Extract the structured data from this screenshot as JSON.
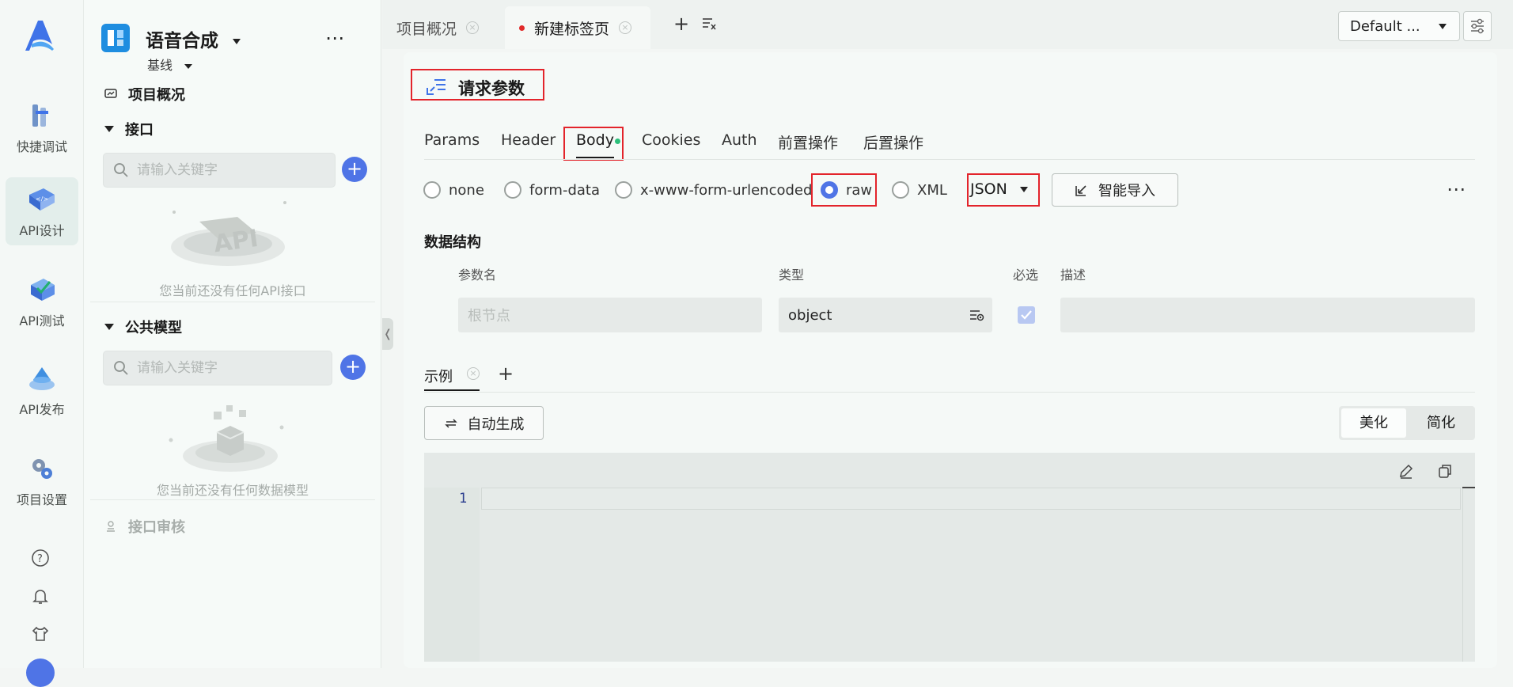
{
  "rail": {
    "items": [
      {
        "label": "快捷调试",
        "icon": "quick-debug-icon"
      },
      {
        "label": "API设计",
        "icon": "api-design-icon",
        "active": true
      },
      {
        "label": "API测试",
        "icon": "api-test-icon"
      },
      {
        "label": "API发布",
        "icon": "api-publish-icon"
      },
      {
        "label": "项目设置",
        "icon": "project-settings-icon"
      }
    ]
  },
  "sidebar": {
    "project_name": "语音合成",
    "branch": "基线",
    "overview_label": "项目概况",
    "interfaces": {
      "title": "接口",
      "search_placeholder": "请输入关键字",
      "empty_text": "您当前还没有任何API接口",
      "empty_art_text": "API"
    },
    "models": {
      "title": "公共模型",
      "search_placeholder": "请输入关键字",
      "empty_text": "您当前还没有任何数据模型"
    },
    "review_label": "接口审核"
  },
  "tabs": {
    "items": [
      {
        "label": "项目概况"
      },
      {
        "label": "新建标签页",
        "active": true,
        "unsaved": true
      }
    ],
    "env": "Default ..."
  },
  "request": {
    "title": "请求参数",
    "sub_tabs": [
      "Params",
      "Header",
      "Body",
      "Cookies",
      "Auth",
      "前置操作",
      "后置操作"
    ],
    "active_sub_tab": "Body",
    "body_types": [
      "none",
      "form-data",
      "x-www-form-urlencoded",
      "raw",
      "XML"
    ],
    "selected_body_type": "raw",
    "format": "JSON",
    "smart_import": "智能导入",
    "schema": {
      "title": "数据结构",
      "columns": [
        "参数名",
        "类型",
        "必选",
        "描述"
      ],
      "root_placeholder": "根节点",
      "root_type": "object",
      "required": true
    },
    "examples": {
      "tab": "示例",
      "auto_generate": "自动生成",
      "beautify": "美化",
      "minify": "简化",
      "line_number": "1"
    }
  },
  "colors": {
    "accent": "#4f74e6",
    "highlight_border": "#e3242b",
    "active_dot": "#2bbf7a"
  }
}
